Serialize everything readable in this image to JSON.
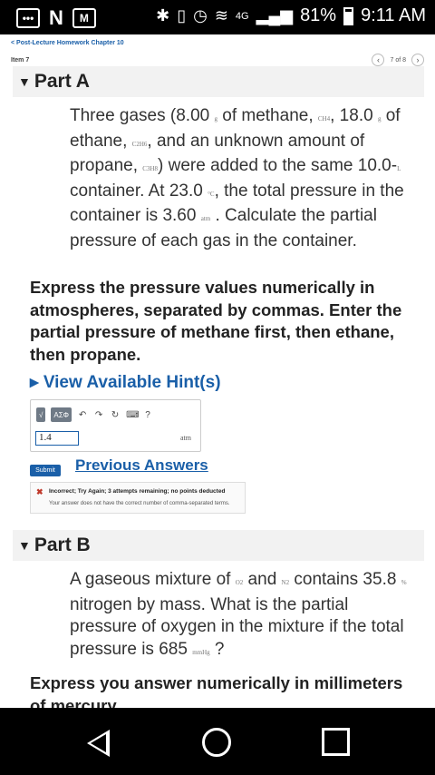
{
  "status_bar": {
    "network": "4G",
    "battery": "81%",
    "time": "9:11 AM",
    "carrier_icon": "N"
  },
  "header": {
    "back_link": "< Post-Lecture Homework Chapter 10",
    "item": "Item 7",
    "pager": "7 of 8"
  },
  "part_a": {
    "title": "Part A",
    "problem": [
      {
        "t": "Three gases (8.00 "
      },
      {
        "u": "g"
      },
      {
        "t": " of methane, "
      },
      {
        "u": "CH4"
      },
      {
        "t": ", 18.0 "
      },
      {
        "u": "g"
      },
      {
        "t": " of ethane, "
      },
      {
        "u": "C2H6"
      },
      {
        "t": ", and an unknown amount of propane, "
      },
      {
        "u": "C3H8"
      },
      {
        "t": ") were added to the same 10.0-"
      },
      {
        "u": "L"
      },
      {
        "t": " container. At 23.0 "
      },
      {
        "u": "°C"
      },
      {
        "t": ", the total pressure in the container is 3.60 "
      },
      {
        "u": "atm"
      },
      {
        "t": " . Calculate the partial pressure of each gas in the container."
      }
    ],
    "instructions": "Express the pressure values numerically in atmospheres, separated by commas. Enter the partial pressure of methane first, then ethane, then propane.",
    "hint": "View Available Hint(s)",
    "toolbar": {
      "templates": "√",
      "symbols": "ΑΣΦ",
      "undo": "↶",
      "redo": "↷",
      "reset": "↻",
      "keyboard": "⌨",
      "help": "?"
    },
    "answer_value": "1.4",
    "unit": "atm",
    "submit": "Submit",
    "previous_answers": "Previous Answers",
    "feedback_title": "Incorrect; Try Again; 3 attempts remaining; no points deducted",
    "feedback_detail": "Your answer does not have the correct number of comma-separated terms."
  },
  "part_b": {
    "title": "Part B",
    "problem": [
      {
        "t": "A gaseous mixture of "
      },
      {
        "u": "O2"
      },
      {
        "t": " and "
      },
      {
        "u": "N2"
      },
      {
        "t": " contains 35.8 "
      },
      {
        "u": "%"
      },
      {
        "t": " nitrogen by mass. What is the partial pressure of oxygen in the mixture if the total pressure is 685 "
      },
      {
        "u": "mmHg"
      },
      {
        "t": " ?"
      }
    ],
    "instructions": "Express you answer numerically in millimeters of mercury."
  }
}
